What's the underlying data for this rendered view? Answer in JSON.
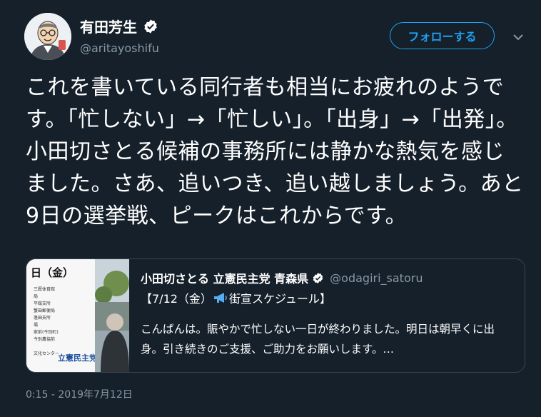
{
  "author": {
    "display_name": "有田芳生",
    "handle": "@aritayoshifu",
    "verified_icon": "verified-badge-icon",
    "avatar_icon": "avatar-illustration"
  },
  "actions": {
    "follow_label": "フォローする",
    "more_icon": "chevron-down-icon"
  },
  "tweet": {
    "text": "これを書いている同行者も相当にお疲れのようです。「忙しない」→「忙しい」。「出身」→「出発」。小田切さとる候補の事務所には静かな熱気を感じました。さあ、追いつき、追い越しましょう。あと9日の選挙戦、ピークはこれからです。",
    "timestamp": "0:15 - 2019年7月12日"
  },
  "quoted": {
    "display_name": "小田切さとる 立憲民主党 青森県",
    "handle": "@odagiri_satoru",
    "line1_before": "【7/12（金）",
    "line1_after": "街宣スケジュール】",
    "body": "こんばんは。賑やかで忙しない一日が終わりました。明日は朝早くに出身。引き続きのご支援、ご助力をお願いします。…",
    "thumbnail": {
      "title": "日（金）",
      "lines": [
        "三厩体育館",
        "局",
        "平舘支所",
        "蟹田郵便局",
        "蓬田支所",
        "場",
        "家前(今別町)",
        "今別農協前",
        "",
        "文化センター"
      ],
      "logo": "立憲民主党"
    }
  },
  "colors": {
    "background": "#15202b",
    "accent": "#1da1f2",
    "secondary_text": "#8899a6",
    "border": "#38444d"
  }
}
